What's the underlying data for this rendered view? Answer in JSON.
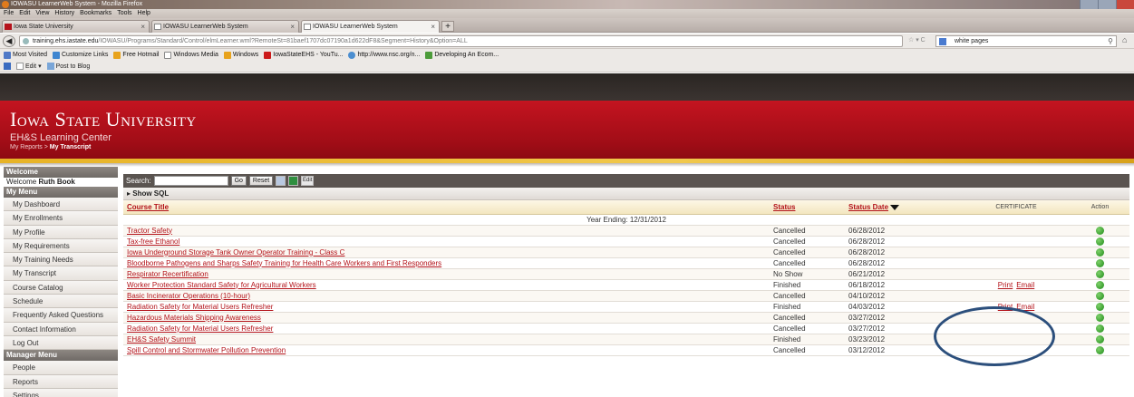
{
  "browser": {
    "window_title": "IOWASU LearnerWeb System - Mozilla Firefox",
    "menu": [
      "File",
      "Edit",
      "View",
      "History",
      "Bookmarks",
      "Tools",
      "Help"
    ],
    "tabs": [
      {
        "label": "Iowa State University"
      },
      {
        "label": "IOWASU LearnerWeb System"
      },
      {
        "label": "IOWASU LearnerWeb System"
      }
    ],
    "url_domain": "training.ehs.iastate.edu",
    "url_path": "/IOWASU/Programs/Standard/Control/elmLearner.wml?RemoteSt=81baef1707dc07190a1d622dF8&Segment=History&Option=ALL",
    "search_value": "white pages",
    "bookmarks": [
      {
        "label": "Most Visited",
        "icon": "bookmark-star-icon",
        "color": "#4f79c7"
      },
      {
        "label": "Customize Links",
        "icon": "customize-icon",
        "color": "#3f86d0"
      },
      {
        "label": "Free Hotmail",
        "icon": "windows-flag-icon",
        "color": "#e8a31c"
      },
      {
        "label": "Windows Media",
        "icon": "page-icon",
        "color": "#ffffff"
      },
      {
        "label": "Windows",
        "icon": "windows-flag-icon",
        "color": "#e8a31c"
      },
      {
        "label": "IowaStateEHS - YouTu...",
        "icon": "youtube-icon",
        "color": "#cc1a1a"
      },
      {
        "label": "http://www.nsc.org/n...",
        "icon": "globe-icon",
        "color": "#4b8ed0"
      },
      {
        "label": "Developing An Ecom...",
        "icon": "page-green-icon",
        "color": "#4c9b3a"
      }
    ],
    "blog_bar": [
      {
        "label": "Edit",
        "icon": "edit-icon"
      },
      {
        "label": "Post to Blog",
        "icon": "blog-icon"
      }
    ]
  },
  "site": {
    "title": "Iowa State University",
    "subtitle": "EH&S Learning Center",
    "breadcrumb_parent": "My Reports",
    "breadcrumb_sep": " > ",
    "breadcrumb_current": "My Transcript"
  },
  "sidebar": {
    "welcome_header": "Welcome",
    "welcome_prefix": "Welcome",
    "user_name": "Ruth Book",
    "my_menu_header": "My Menu",
    "my_menu": [
      "My Dashboard",
      "My Enrollments",
      "My Profile",
      "My Requirements",
      "My Training Needs",
      "My Transcript",
      "Course Catalog",
      "Schedule",
      "Frequently Asked Questions",
      "Contact Information",
      "Log Out"
    ],
    "manager_header": "Manager Menu",
    "manager_menu": [
      "People",
      "Reports",
      "Settings"
    ]
  },
  "toolbar": {
    "search_label": "Search:",
    "search_value": "",
    "go_label": "Go",
    "reset_label": "Reset",
    "edit_label": "Edit"
  },
  "show_sql": "Show SQL",
  "table": {
    "headers": {
      "course_title": "Course Title",
      "status": "Status",
      "status_date": "Status Date",
      "certificate": "CERTIFICATE",
      "action": "Action"
    },
    "year_row": "Year Ending: 12/31/2012",
    "rows": [
      {
        "title": "Tractor Safety",
        "status": "Cancelled",
        "date": "06/28/2012",
        "print": "",
        "email": ""
      },
      {
        "title": "Tax-free Ethanol",
        "status": "Cancelled",
        "date": "06/28/2012",
        "print": "",
        "email": ""
      },
      {
        "title": "Iowa Underground Storage Tank Owner Operator Training - Class C",
        "status": "Cancelled",
        "date": "06/28/2012",
        "print": "",
        "email": ""
      },
      {
        "title": "Bloodborne Pathogens and Sharps Safety Training for Health Care Workers and First Responders",
        "status": "Cancelled",
        "date": "06/28/2012",
        "print": "",
        "email": ""
      },
      {
        "title": "Respirator Recertification",
        "status": "No Show",
        "date": "06/21/2012",
        "print": "",
        "email": ""
      },
      {
        "title": "Worker Protection Standard Safety for Agricultural Workers",
        "status": "Finished",
        "date": "06/18/2012",
        "print": "Print",
        "email": "Email"
      },
      {
        "title": "Basic Incinerator Operations (10-hour)",
        "status": "Cancelled",
        "date": "04/10/2012",
        "print": "",
        "email": ""
      },
      {
        "title": "Radiation Safety for Material Users Refresher",
        "status": "Finished",
        "date": "04/03/2012",
        "print": "Print",
        "email": "Email"
      },
      {
        "title": "Hazardous Materials Shipping Awareness",
        "status": "Cancelled",
        "date": "03/27/2012",
        "print": "",
        "email": ""
      },
      {
        "title": "Radiation Safety for Material Users Refresher",
        "status": "Cancelled",
        "date": "03/27/2012",
        "print": "",
        "email": ""
      },
      {
        "title": "EH&S Safety Summit",
        "status": "Finished",
        "date": "03/23/2012",
        "print": "",
        "email": ""
      },
      {
        "title": "Spill Control and Stormwater Pollution Prevention",
        "status": "Cancelled",
        "date": "03/12/2012",
        "print": "",
        "email": ""
      }
    ]
  },
  "colors": {
    "brand_red": "#c41420",
    "gold": "#f1c84c",
    "link_red": "#b31219",
    "annotation_blue": "#2c4f7c"
  }
}
